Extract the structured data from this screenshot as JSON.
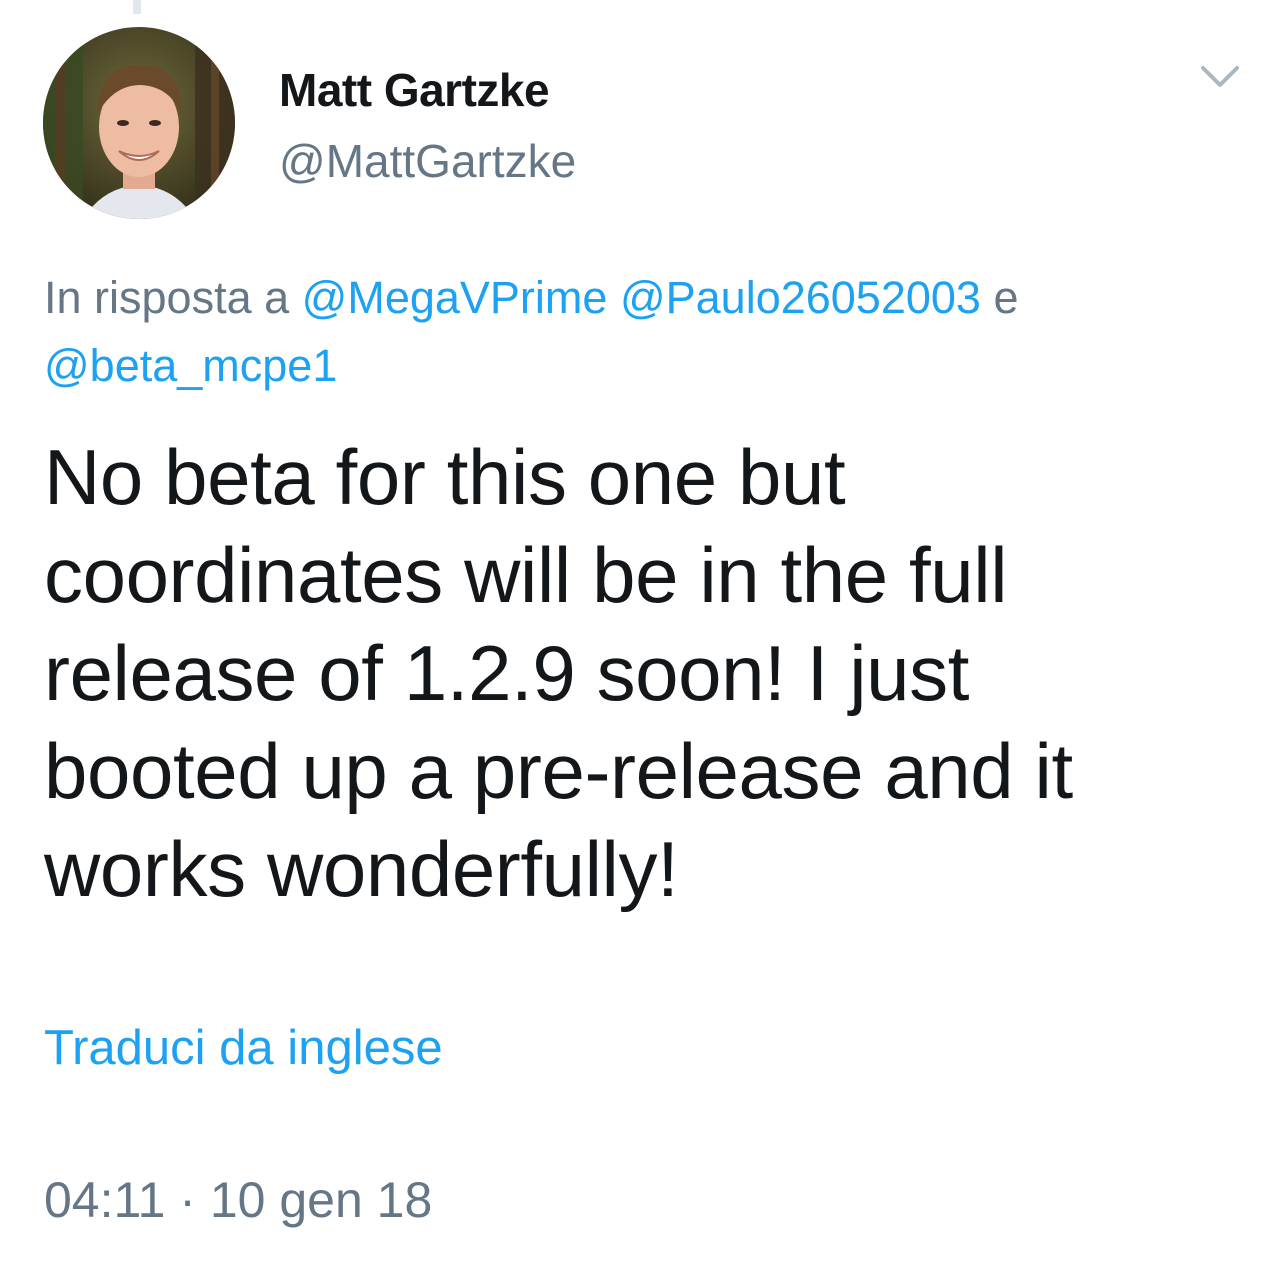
{
  "tweet": {
    "author": {
      "name": "Matt Gartzke",
      "handle": "@MattGartzke"
    },
    "reply_context": {
      "prefix": "In risposta a",
      "mention_1": "@MegaVPrime",
      "mention_2": "@Paulo26052003",
      "conjunction": "e",
      "mention_3": "@beta_mcpe1"
    },
    "text": "No beta for this one but coordinates will be in the full release of 1.2.9 soon! I just booted up a pre-release and it works wonderfully!",
    "translate_label": "Traduci da inglese",
    "timestamp": "04:11 · 10 gen 18"
  },
  "icons": {
    "menu": "chevron-down-icon"
  },
  "colors": {
    "link": "#1da1f2",
    "secondary_text": "#657786",
    "primary_text": "#14171a",
    "thread_line": "#e1e8ed"
  }
}
